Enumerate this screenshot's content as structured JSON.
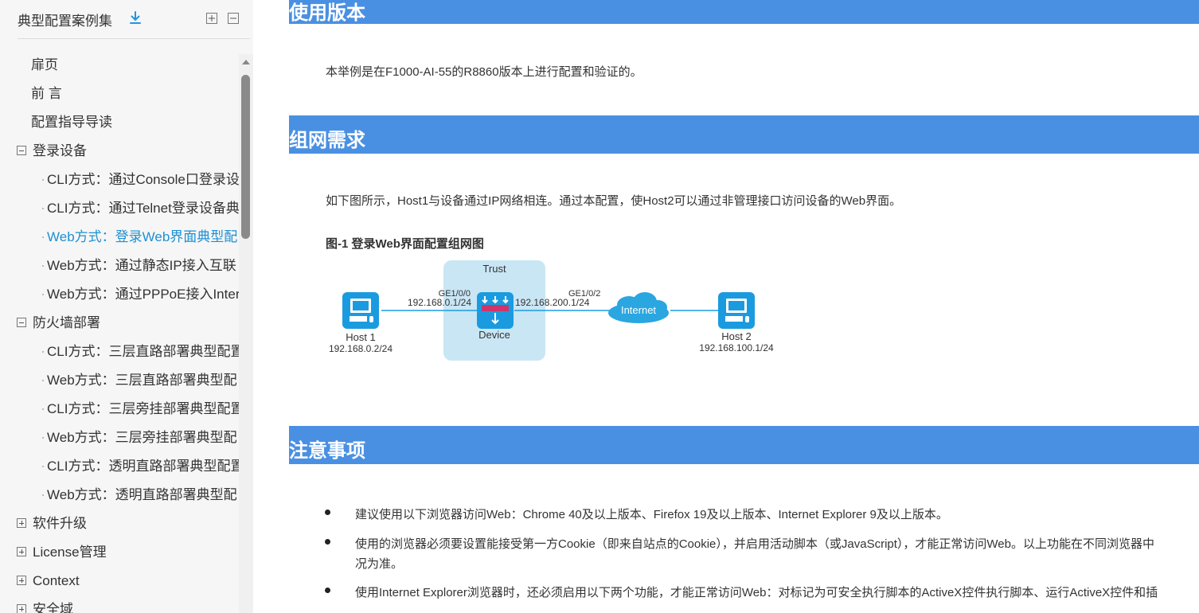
{
  "sidebar": {
    "title": "典型配置案例集",
    "items": [
      {
        "label": "扉页"
      },
      {
        "label": "前 言"
      },
      {
        "label": "配置指导导读"
      },
      {
        "label": "登录设备"
      },
      {
        "label": "CLI方式：通过Console口登录设"
      },
      {
        "label": "CLI方式：通过Telnet登录设备典"
      },
      {
        "label": "Web方式：登录Web界面典型配"
      },
      {
        "label": "Web方式：通过静态IP接入互联"
      },
      {
        "label": "Web方式：通过PPPoE接入Inter"
      },
      {
        "label": "防火墙部署"
      },
      {
        "label": "CLI方式：三层直路部署典型配置"
      },
      {
        "label": "Web方式：三层直路部署典型配"
      },
      {
        "label": "CLI方式：三层旁挂部署典型配置"
      },
      {
        "label": "Web方式：三层旁挂部署典型配"
      },
      {
        "label": "CLI方式：透明直路部署典型配置"
      },
      {
        "label": "Web方式：透明直路部署典型配"
      },
      {
        "label": "软件升级"
      },
      {
        "label": "License管理"
      },
      {
        "label": "Context"
      },
      {
        "label": "安全域"
      }
    ]
  },
  "content": {
    "section_version": {
      "heading": "使用版本",
      "text": "本举例是在F1000-AI-55的R8860版本上进行配置和验证的。"
    },
    "section_network": {
      "heading": "组网需求",
      "text": "如下图所示，Host1与设备通过IP网络相连。通过本配置，使Host2可以通过非管理接口访问设备的Web界面。",
      "figure_title": "图-1 登录Web界面配置组网图",
      "diagram": {
        "zone_label": "Trust",
        "device_label": "Device",
        "host1_label": "Host 1",
        "host1_ip": "192.168.0.2/24",
        "port1_label": "GE1/0/0",
        "port1_ip": "192.168.0.1/24",
        "port2_label": "GE1/0/2",
        "port2_ip": "192.168.200.1/24",
        "cloud_label": "Internet",
        "host2_label": "Host 2",
        "host2_ip": "192.168.100.1/24"
      }
    },
    "section_notes": {
      "heading": "注意事项",
      "bullets": [
        "建议使用以下浏览器访问Web：Chrome 40及以上版本、Firefox 19及以上版本、Internet Explorer 9及以上版本。",
        "使用的浏览器必须要设置能接受第一方Cookie（即来自站点的Cookie），并启用活动脚本（或JavaScript），才能正常访问Web。以上功能在不同浏览器中",
        "况为准。",
        "使用Internet Explorer浏览器时，还必须启用以下两个功能，才能正常访问Web：对标记为可安全执行脚本的ActiveX控件执行脚本、运行ActiveX控件和插"
      ]
    }
  },
  "colors": {
    "accent": "#4a90e2",
    "active_link": "#1e90d2",
    "trust_zone": "#c9e6f5",
    "icon_blue": "#1a9be0"
  }
}
